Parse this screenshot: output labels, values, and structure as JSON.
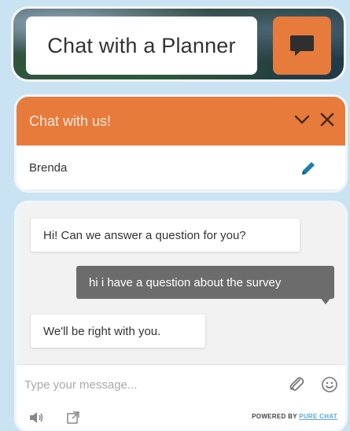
{
  "launcher": {
    "label": "Chat with a Planner"
  },
  "header": {
    "title": "Chat with us!",
    "agent_name": "Brenda"
  },
  "messages": [
    {
      "sender": "agent",
      "text": "Hi! Can we answer a question for you?"
    },
    {
      "sender": "visitor",
      "text": "hi i have a question about the survey"
    },
    {
      "sender": "agent",
      "text": "We'll be right with you."
    }
  ],
  "composer": {
    "placeholder": "Type your message..."
  },
  "footer": {
    "powered_by": "POWERED BY",
    "brand": "PURE CHAT"
  },
  "colors": {
    "accent": "#e77b3c",
    "visitor_bubble": "#6c6c6c",
    "brand_link": "#5da9d6"
  }
}
